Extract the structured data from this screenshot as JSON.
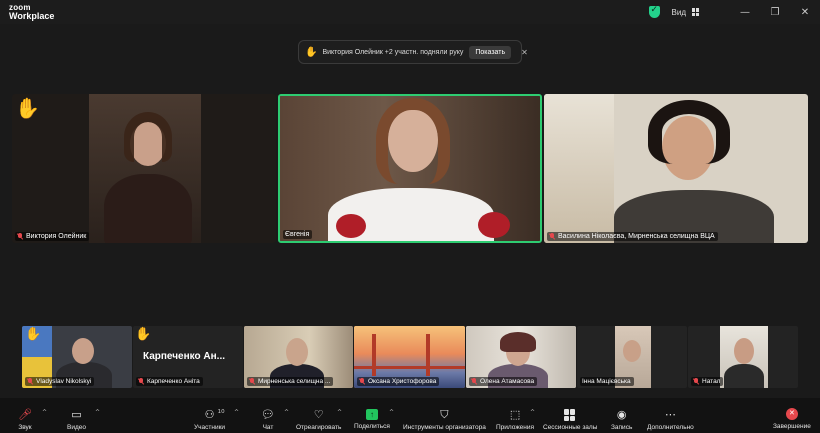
{
  "app": {
    "logo_line1": "zoom",
    "logo_line2": "Workplace"
  },
  "titlebar": {
    "view_label": "Вид",
    "minimize": "—",
    "restore": "❐",
    "close": "✕"
  },
  "notification": {
    "message": "Виктория Олейник +2 участн. подняли руку",
    "action_label": "Показать",
    "close": "✕"
  },
  "main_tiles": [
    {
      "name": "Виктория Олейник",
      "hand_raised": true
    },
    {
      "name": "Євгенія",
      "active_speaker": true,
      "border_color": "#2ecc71"
    },
    {
      "name": "Василина Ніколаєва, Мирненська селищна ВЦА"
    }
  ],
  "strip_tiles": [
    {
      "name": "Vladyslav Nikolskyi",
      "hand_raised": true
    },
    {
      "name": "Карпеченко Аніта",
      "display": "Карпеченко  Ан...",
      "hand_raised": true
    },
    {
      "name": "Мирненська селищна ..."
    },
    {
      "name": "Оксана Христофорова"
    },
    {
      "name": "Олена Атамасова"
    },
    {
      "name": "Інна Мацієвська"
    },
    {
      "name": "Натал"
    }
  ],
  "toolbar": {
    "audio": "Звук",
    "video": "Видео",
    "participants": "Участники",
    "participants_count": "10",
    "chat": "Чат",
    "react": "Отреагировать",
    "share": "Поделиться",
    "host_tools": "Инструменты организатора",
    "apps": "Приложения",
    "breakout": "Сессионные залы",
    "record": "Запись",
    "more": "Дополнительно",
    "end": "Завершение"
  },
  "colors": {
    "accent_green": "#2ecc71",
    "muted_red": "#e5484d",
    "hand_yellow": "#f5c518"
  }
}
